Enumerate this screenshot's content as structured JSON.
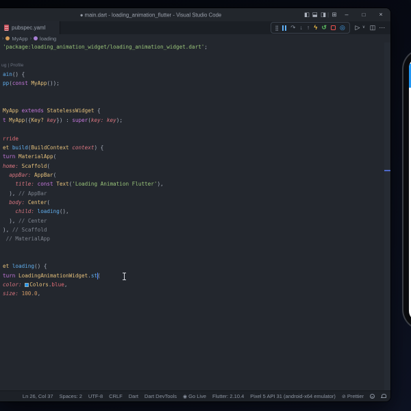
{
  "window": {
    "title": "● main.dart - loading_animation_flutter - Visual Studio Code",
    "controls": {
      "minimize": "–",
      "maximize": "□",
      "close": "×",
      "layout_separator": "|",
      "customize_layout": "⊞",
      "layout_left": "◧",
      "layout_right": "◨"
    }
  },
  "tabbar": {
    "tabs": [
      {
        "label": "pubspec.yaml"
      }
    ]
  },
  "editor_actions": {
    "run": "▷",
    "run_dropdown": "∨",
    "split": "◫",
    "more": "⋯"
  },
  "debug_toolbar": {
    "icons": [
      {
        "name": "gripper",
        "glyph": ""
      },
      {
        "name": "pause",
        "glyph": ""
      },
      {
        "name": "step-over",
        "glyph": "↷"
      },
      {
        "name": "step-into",
        "glyph": "↓"
      },
      {
        "name": "step-out",
        "glyph": "↑"
      },
      {
        "name": "hot-reload",
        "glyph": "ϟ"
      },
      {
        "name": "restart",
        "glyph": "↺"
      },
      {
        "name": "stop",
        "glyph": ""
      },
      {
        "name": "inspect-widget",
        "glyph": "◎"
      }
    ]
  },
  "breadcrumbs": {
    "sep": "›",
    "items": [
      "MyApp",
      "loading"
    ]
  },
  "editor": {
    "cursor": {
      "ln": 26,
      "col": 37
    },
    "accent_colors": {
      "caret": "#528bff",
      "swatch_blue": "#2196f3"
    },
    "lines": [
      {
        "segs": [
          [
            "'package:loading_animation_widget/loading_animation_widget.dart'",
            "str"
          ],
          [
            ";",
            "pn"
          ]
        ]
      },
      {
        "segs": []
      },
      {
        "lens": true,
        "segs": [
          [
            "ug | Profile",
            "lens"
          ]
        ]
      },
      {
        "segs": [
          [
            "ain",
            "fn"
          ],
          [
            "() {",
            "pn"
          ]
        ]
      },
      {
        "segs": [
          [
            "pp",
            "fn"
          ],
          [
            "(",
            "pn"
          ],
          [
            "const",
            "kw"
          ],
          [
            " ",
            "pn"
          ],
          [
            "MyApp",
            "type"
          ],
          [
            "());",
            "pn"
          ]
        ]
      },
      {
        "segs": []
      },
      {
        "segs": []
      },
      {
        "segs": [
          [
            "MyApp",
            "type"
          ],
          [
            " ",
            "pn"
          ],
          [
            "extends",
            "kw"
          ],
          [
            " ",
            "pn"
          ],
          [
            "StatelessWidget",
            "type"
          ],
          [
            " {",
            "pn"
          ]
        ]
      },
      {
        "segs": [
          [
            "t",
            "kw"
          ],
          [
            " ",
            "pn"
          ],
          [
            "MyApp",
            "type"
          ],
          [
            "({",
            "pn"
          ],
          [
            "Key?",
            "type"
          ],
          [
            " ",
            "pn"
          ],
          [
            "key",
            "param"
          ],
          [
            "}) : ",
            "pn"
          ],
          [
            "super",
            "kw"
          ],
          [
            "(",
            "pn"
          ],
          [
            "key: ",
            "named"
          ],
          [
            "key",
            "param"
          ],
          [
            ");",
            "pn"
          ]
        ]
      },
      {
        "segs": []
      },
      {
        "segs": [
          [
            "rride",
            "annot"
          ]
        ]
      },
      {
        "segs": [
          [
            "et",
            "type"
          ],
          [
            " ",
            "pn"
          ],
          [
            "build",
            "fn"
          ],
          [
            "(",
            "pn"
          ],
          [
            "BuildContext",
            "type"
          ],
          [
            " ",
            "pn"
          ],
          [
            "context",
            "param"
          ],
          [
            ") {",
            "pn"
          ]
        ]
      },
      {
        "segs": [
          [
            "turn",
            "kw"
          ],
          [
            " ",
            "pn"
          ],
          [
            "MaterialApp",
            "type"
          ],
          [
            "(",
            "pn"
          ]
        ]
      },
      {
        "segs": [
          [
            "home: ",
            "named"
          ],
          [
            "Scaffold",
            "type"
          ],
          [
            "(",
            "pn"
          ]
        ]
      },
      {
        "segs": [
          [
            "  ",
            "pn"
          ],
          [
            "appBar: ",
            "named"
          ],
          [
            "AppBar",
            "type"
          ],
          [
            "(",
            "pn"
          ]
        ]
      },
      {
        "segs": [
          [
            "    ",
            "pn"
          ],
          [
            "title: ",
            "named"
          ],
          [
            "const",
            "kw"
          ],
          [
            " ",
            "pn"
          ],
          [
            "Text",
            "type"
          ],
          [
            "(",
            "pn"
          ],
          [
            "'Loading Animation Flutter'",
            "str"
          ],
          [
            "),",
            "pn"
          ]
        ]
      },
      {
        "segs": [
          [
            "  ), ",
            "pn"
          ],
          [
            "// AppBar",
            "cm"
          ]
        ]
      },
      {
        "segs": [
          [
            "  ",
            "pn"
          ],
          [
            "body: ",
            "named"
          ],
          [
            "Center",
            "type"
          ],
          [
            "(",
            "pn"
          ]
        ]
      },
      {
        "segs": [
          [
            "    ",
            "pn"
          ],
          [
            "child: ",
            "named"
          ],
          [
            "loading",
            "fn"
          ],
          [
            "(),",
            "pn"
          ]
        ]
      },
      {
        "segs": [
          [
            "  ), ",
            "pn"
          ],
          [
            "// Center",
            "cm"
          ]
        ]
      },
      {
        "segs": [
          [
            "), ",
            "pn"
          ],
          [
            "// Scaffold",
            "cm"
          ]
        ]
      },
      {
        "segs": [
          [
            " ",
            "pn"
          ],
          [
            "// MaterialApp",
            "cm"
          ]
        ]
      },
      {
        "segs": []
      },
      {
        "segs": []
      },
      {
        "segs": [
          [
            "et",
            "type"
          ],
          [
            " ",
            "pn"
          ],
          [
            "loading",
            "fn"
          ],
          [
            "() {",
            "pn"
          ]
        ]
      },
      {
        "segs": [
          [
            "turn",
            "kw"
          ],
          [
            " ",
            "pn"
          ],
          [
            "LoadingAnimationWidget",
            "type"
          ],
          [
            ".",
            "pn"
          ],
          [
            "st",
            "fn"
          ],
          [
            "",
            "caret"
          ],
          [
            "(",
            "pn"
          ]
        ]
      },
      {
        "segs": [
          [
            "color: ",
            "named"
          ],
          [
            "",
            "swatch"
          ],
          [
            "Colors",
            "type"
          ],
          [
            ".",
            "pn"
          ],
          [
            "blue",
            "prop"
          ],
          [
            ",",
            "pn"
          ]
        ]
      },
      {
        "segs": [
          [
            "size: ",
            "named"
          ],
          [
            "100.0",
            "num"
          ],
          [
            ",",
            "pn"
          ]
        ]
      }
    ]
  },
  "statusbar": {
    "items": [
      {
        "label": "Ln 26, Col 37"
      },
      {
        "label": "Spaces: 2"
      },
      {
        "label": "UTF-8"
      },
      {
        "label": "CRLF"
      },
      {
        "label": "Dart"
      },
      {
        "label": "Dart DevTools"
      },
      {
        "icon": "◉",
        "label": "Go Live"
      },
      {
        "label": "Flutter: 2.10.4"
      },
      {
        "label": "Pixel 5 API 31 (android-x64 emulator)"
      },
      {
        "icon": "⊘",
        "label": "Prettier"
      }
    ]
  },
  "phone": {
    "appbar_color": "#2196f3",
    "screen_color": "#ffffff"
  }
}
